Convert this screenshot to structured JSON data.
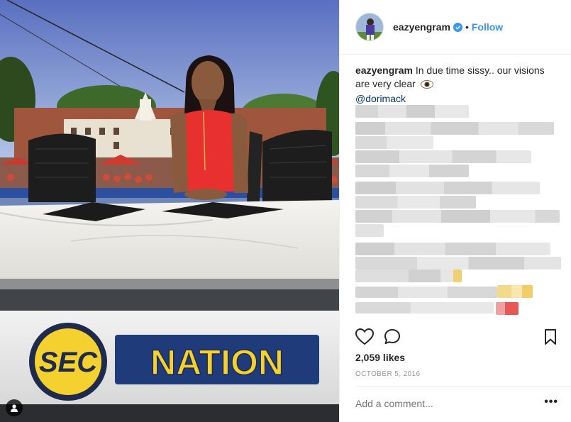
{
  "post": {
    "username": "eazyengram",
    "follow_label": "Follow",
    "separator": "•",
    "caption_text": "In due time sissy.. our visions are very clear",
    "mention": "@dorimack",
    "likes": "2,059 likes",
    "date": "OCTOBER 5, 2016",
    "comment_placeholder": "Add a comment...",
    "more_label": "•••"
  },
  "photo": {
    "desk_logo_left": "SEC",
    "desk_logo_right": "NATION"
  },
  "colors": {
    "accent": "#3897f0",
    "mention": "#003569",
    "text": "#262626",
    "muted": "#999999",
    "dress": "#e8312f"
  },
  "icons": [
    "verified-icon",
    "heart-icon",
    "comment-icon",
    "bookmark-icon",
    "user-tag-icon",
    "eye-emoji-icon"
  ]
}
